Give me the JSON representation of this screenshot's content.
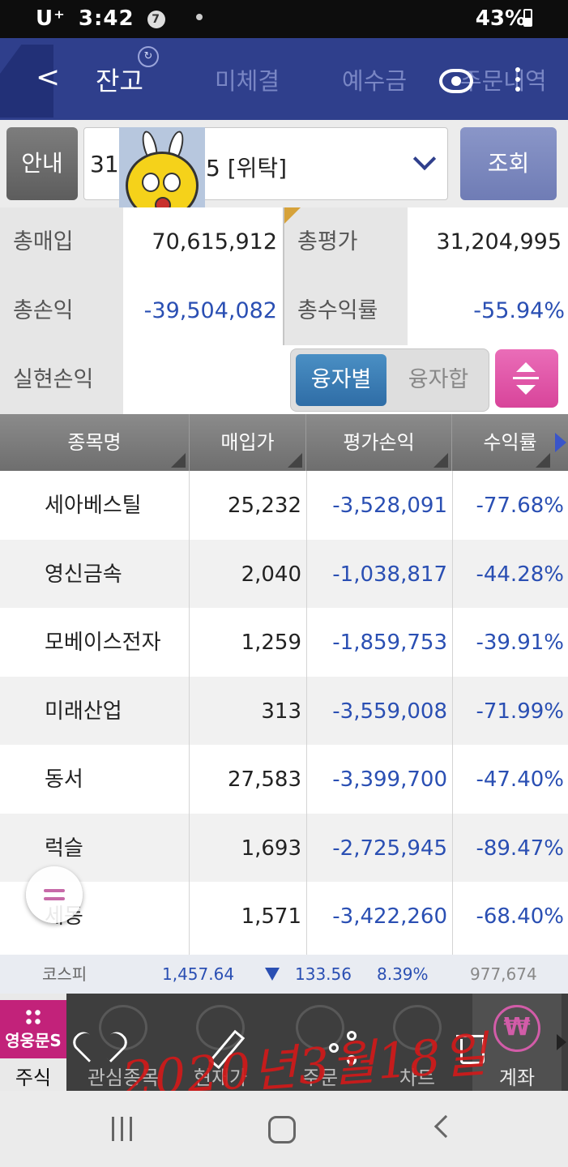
{
  "status_bar": {
    "carrier": "U⁺",
    "time": "3:42",
    "notif_count": "7",
    "battery": "43%"
  },
  "header": {
    "tabs": [
      {
        "label": "잔고",
        "active": true
      },
      {
        "label": "미체결",
        "active": false
      },
      {
        "label": "예수금",
        "active": false
      },
      {
        "label": "주문내역",
        "active": false
      }
    ]
  },
  "account": {
    "guide_label": "안내",
    "account_prefix": "31",
    "account_suffix": "5 [위탁]",
    "query_label": "조회"
  },
  "summary": {
    "total_purchase_label": "총매입",
    "total_purchase_value": "70,615,912",
    "total_eval_label": "총평가",
    "total_eval_value": "31,204,995",
    "total_pnl_label": "총손익",
    "total_pnl_value": "-39,504,082",
    "total_return_label": "총수익률",
    "total_return_value": "-55.94%",
    "realized_label": "실현손익",
    "realized_value": "",
    "toggle_on": "융자별",
    "toggle_off": "융자합"
  },
  "table": {
    "columns": [
      "종목명",
      "매입가",
      "평가손익",
      "수익률"
    ],
    "rows": [
      {
        "name": "세아베스틸",
        "price": "25,232",
        "pnl": "-3,528,091",
        "rate": "-77.68%"
      },
      {
        "name": "영신금속",
        "price": "2,040",
        "pnl": "-1,038,817",
        "rate": "-44.28%"
      },
      {
        "name": "모베이스전자",
        "price": "1,259",
        "pnl": "-1,859,753",
        "rate": "-39.91%"
      },
      {
        "name": "미래산업",
        "price": "313",
        "pnl": "-3,559,008",
        "rate": "-71.99%"
      },
      {
        "name": "동서",
        "price": "27,583",
        "pnl": "-3,399,700",
        "rate": "-47.40%"
      },
      {
        "name": "럭슬",
        "price": "1,693",
        "pnl": "-2,725,945",
        "rate": "-89.47%"
      },
      {
        "name": "세동",
        "price": "1,571",
        "pnl": "-3,422,260",
        "rate": "-68.40%"
      }
    ]
  },
  "index_bar": {
    "name": "코스피",
    "value": "1,457.64",
    "change": "133.56",
    "percent": "8.39%",
    "volume": "977,674"
  },
  "bottom_nav": {
    "stock_logo": "영웅문S",
    "stock": "주식",
    "watch": "관심종목",
    "quote": "현재가",
    "order": "주문",
    "chart": "차트",
    "account": "계좌",
    "account_symbol": "₩"
  },
  "handwriting": "2020년3월18일",
  "colors": {
    "header": "#2f3f8c",
    "negative": "#2a4fb3",
    "accent_pink": "#d8449a",
    "toggle_blue": "#2f6da6"
  }
}
